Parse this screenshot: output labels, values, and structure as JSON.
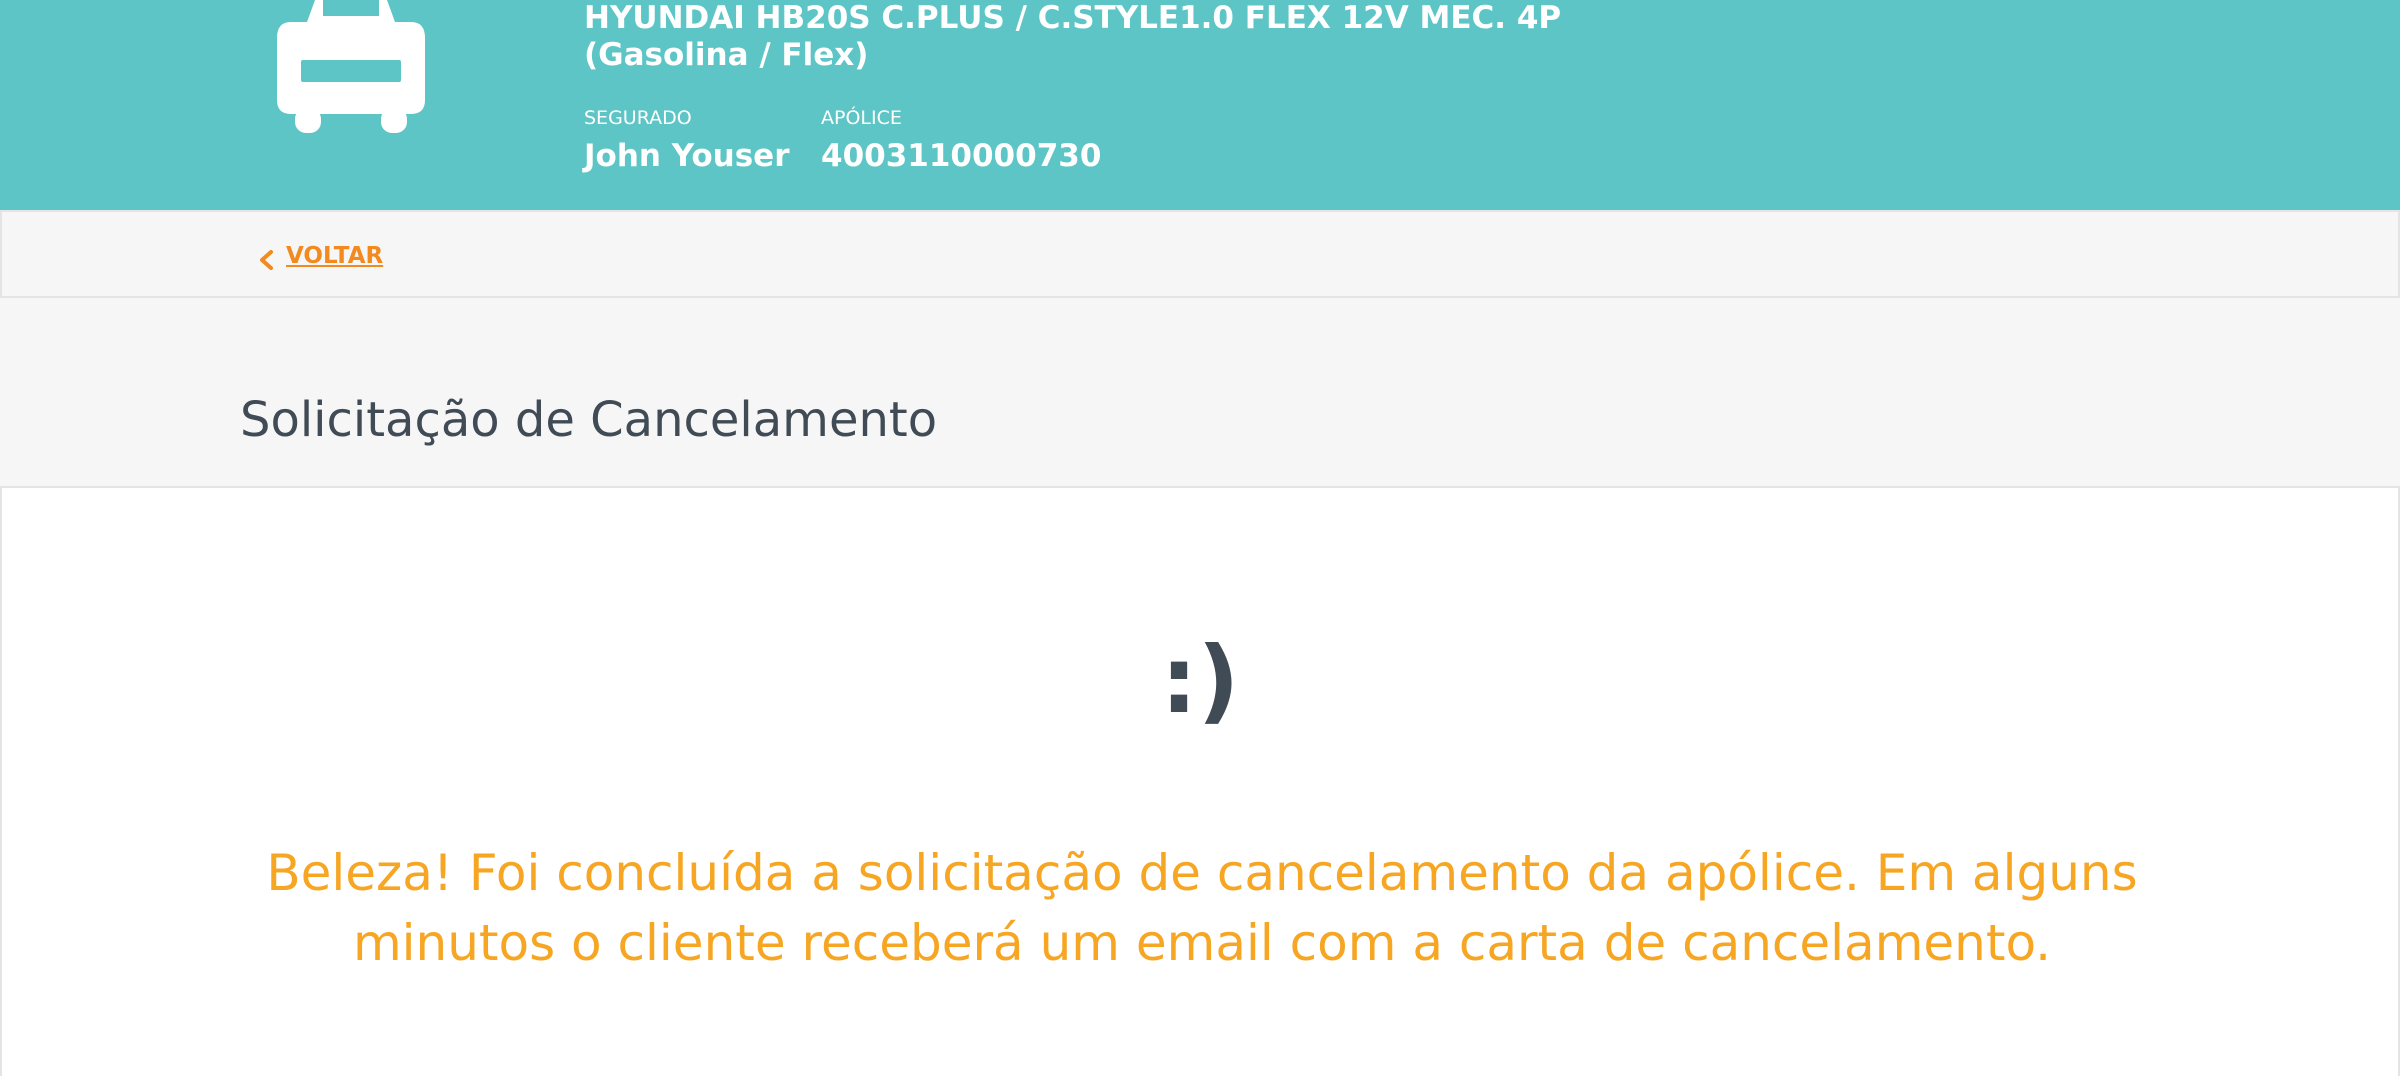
{
  "header": {
    "vehicle_icon": "car-icon",
    "vehicle_title": "HYUNDAI HB20S C.PLUS / C.STYLE1.0 FLEX 12V MEC. 4P (Gasolina / Flex)",
    "insured_label": "SEGURADO",
    "insured_name": "John Youser",
    "policy_label": "APÓLICE",
    "policy_number": "4003110000730",
    "background_color": "#5ec5c6"
  },
  "nav": {
    "back_icon": "chevron-left-icon",
    "back_label": "VOLTAR",
    "link_color": "#f28a1f"
  },
  "page": {
    "title": "Solicitação de Cancelamento"
  },
  "result": {
    "emoticon": ":)",
    "message": "Beleza! Foi concluída a solicitação de cancelamento da apólice. Em alguns minutos o cliente receberá um email com a carta de cancelamento.",
    "message_color": "#f6a623"
  }
}
